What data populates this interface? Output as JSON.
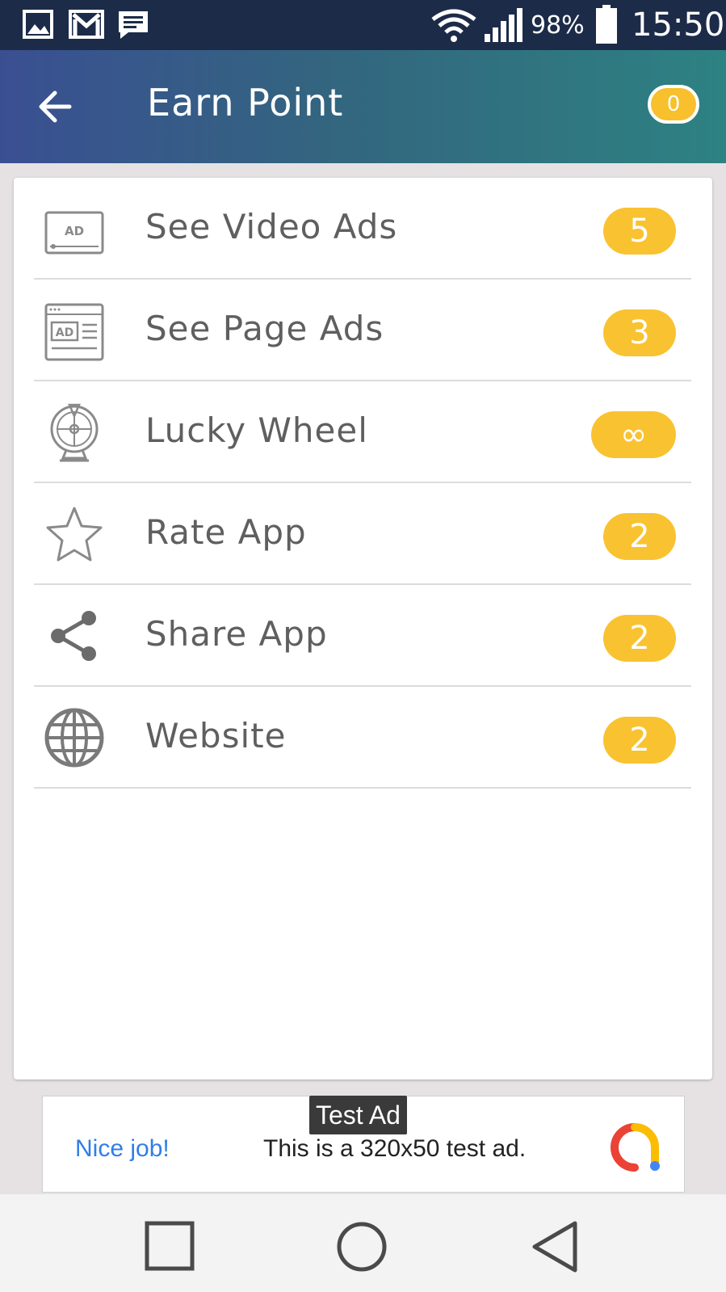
{
  "status_bar": {
    "battery": "98%",
    "time": "15:50",
    "notification_icons": [
      "image-icon",
      "gmail-icon",
      "message-icon"
    ]
  },
  "app_bar": {
    "title": "Earn Point",
    "points": "0"
  },
  "items": [
    {
      "label": "See Video Ads",
      "value": "5",
      "icon": "video-ad-icon"
    },
    {
      "label": "See Page Ads",
      "value": "3",
      "icon": "page-ad-icon"
    },
    {
      "label": "Lucky Wheel",
      "value": "∞",
      "icon": "lucky-wheel-icon"
    },
    {
      "label": "Rate App",
      "value": "2",
      "icon": "star-icon"
    },
    {
      "label": "Share App",
      "value": "2",
      "icon": "share-icon"
    },
    {
      "label": "Website",
      "value": "2",
      "icon": "globe-icon"
    }
  ],
  "ad": {
    "tag": "Test Ad",
    "headline": "Nice job!",
    "message": "This is a 320x50 test ad."
  },
  "colors": {
    "badge": "#f9c231",
    "appbar_start": "#3a4f92",
    "appbar_end": "#2d8282",
    "status_bar": "#1c2b48"
  }
}
